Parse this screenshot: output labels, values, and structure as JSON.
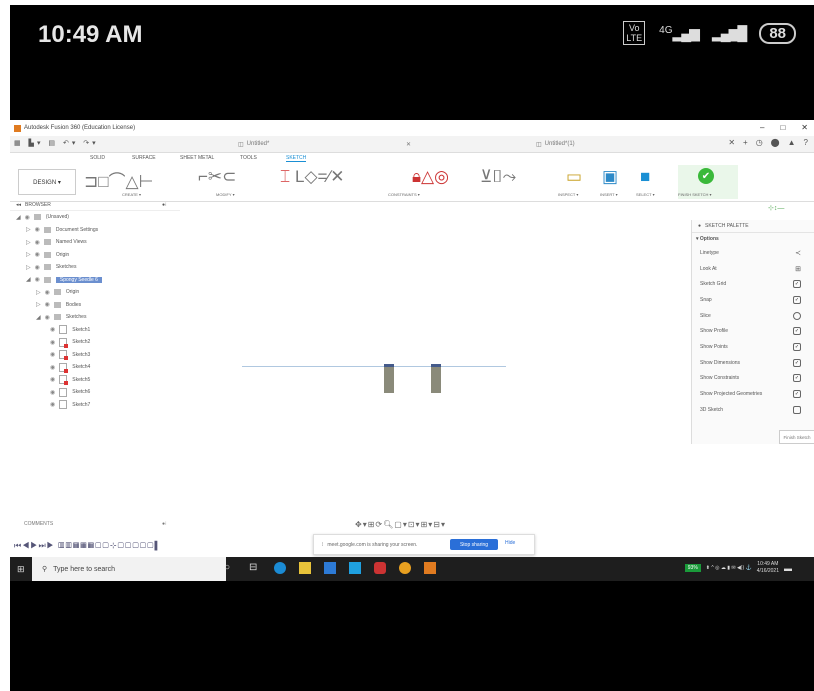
{
  "phone": {
    "time": "10:49 AM",
    "volte_line1": "Vo",
    "volte_line2": "LTE",
    "network": "4G",
    "battery": "88"
  },
  "window": {
    "title": "Autodesk Fusion 360 (Education License)",
    "tab_left": "Untitled*",
    "tab_right": "Untitled*(1)",
    "minimize": "–",
    "maximize": "□",
    "close": "✕"
  },
  "ribbon": {
    "tabs": [
      "SOLID",
      "SURFACE",
      "SHEET METAL",
      "TOOLS",
      "SKETCH"
    ],
    "active_tab": "SKETCH",
    "design_label": "DESIGN ▾",
    "groups": {
      "create": "CREATE ▾",
      "modify": "MODIFY ▾",
      "constraints": "CONSTRAINTS ▾",
      "inspect": "INSPECT ▾",
      "insert": "INSERT ▾",
      "select": "SELECT ▾",
      "finish": "FINISH SKETCH ▾"
    }
  },
  "browser": {
    "header": "BROWSER",
    "items": [
      {
        "label": "(Unsaved)",
        "indent": 0
      },
      {
        "label": "Document Settings",
        "indent": 1
      },
      {
        "label": "Named Views",
        "indent": 1
      },
      {
        "label": "Origin",
        "indent": 1
      },
      {
        "label": "Sketches",
        "indent": 1
      },
      {
        "label": "Spongy Seedle 6",
        "indent": 1,
        "selected": true
      },
      {
        "label": "Origin",
        "indent": 2
      },
      {
        "label": "Bodies",
        "indent": 2
      },
      {
        "label": "Sketches",
        "indent": 2
      },
      {
        "label": "Sketch1",
        "indent": 3
      },
      {
        "label": "Sketch2",
        "indent": 3
      },
      {
        "label": "Sketch3",
        "indent": 3
      },
      {
        "label": "Sketch4",
        "indent": 3
      },
      {
        "label": "Sketch5",
        "indent": 3
      },
      {
        "label": "Sketch6",
        "indent": 3
      },
      {
        "label": "Sketch7",
        "indent": 3
      }
    ]
  },
  "palette": {
    "header": "SKETCH PALETTE",
    "options_label": "▾ Options",
    "rows": [
      {
        "label": "Linetype",
        "state": "icon"
      },
      {
        "label": "Look At",
        "state": "icon"
      },
      {
        "label": "Sketch Grid",
        "state": "checked"
      },
      {
        "label": "Snap",
        "state": "checked"
      },
      {
        "label": "Slice",
        "state": "round"
      },
      {
        "label": "Show Profile",
        "state": "checked"
      },
      {
        "label": "Show Points",
        "state": "checked"
      },
      {
        "label": "Show Dimensions",
        "state": "checked"
      },
      {
        "label": "Show Constraints",
        "state": "checked"
      },
      {
        "label": "Show Projected Geometries",
        "state": "checked"
      },
      {
        "label": "3D Sketch",
        "state": "unchecked"
      }
    ],
    "finish_button": "Finish Sketch"
  },
  "comments": {
    "label": "COMMENTS"
  },
  "share_bar": {
    "text": "meet.google.com is sharing your screen.",
    "stop_label": "Stop sharing",
    "hide_label": "Hide"
  },
  "taskbar": {
    "search_placeholder": "Type here to search",
    "battery_pct": "93%",
    "clock_time": "10:49 AM",
    "clock_date": "4/16/2021"
  },
  "colors": {
    "accent": "#1a8fd4",
    "finish_green": "#3ab93a",
    "stop_blue": "#2a6fd8"
  }
}
